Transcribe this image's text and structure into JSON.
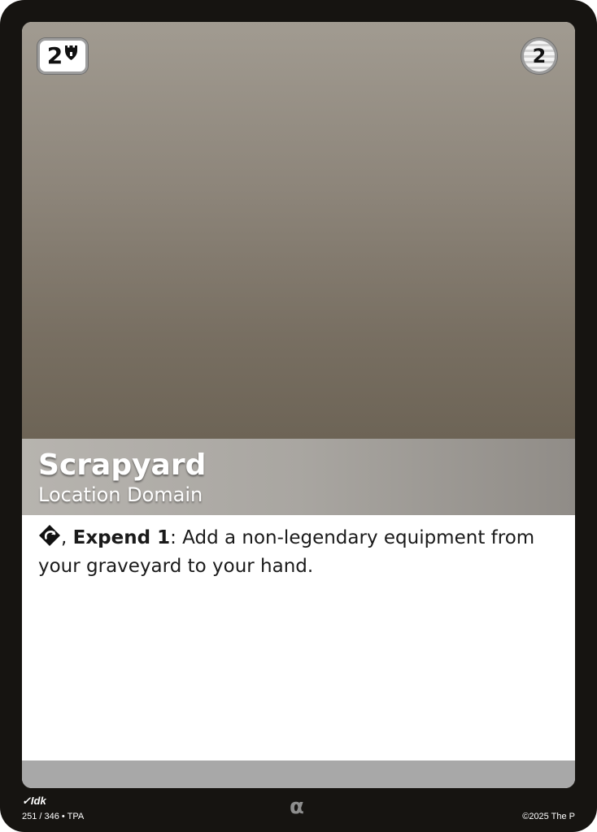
{
  "card": {
    "cost": "2",
    "cost_icon": "fortress-icon",
    "power": "2",
    "name": "Scrapyard",
    "type_line": "Location Domain",
    "rules": {
      "cost_icon": "exhaust-icon",
      "separator": ", ",
      "keyword": "Expend 1",
      "colon": ":",
      "effect": " Add a non-legendary equipment from your graveyard to your hand."
    },
    "artist": "Idk",
    "collector_number": "251 / 346 • TPA",
    "rarity_symbol": "α",
    "copyright": "©2025 The P"
  },
  "colors": {
    "card_border": "#161411",
    "art_top": "#a19b91",
    "art_bottom": "#6d6456",
    "title_bar": "#a9a6a1",
    "bottom_strip": "#a8a8a8",
    "rarity": "#8e8e8e"
  }
}
